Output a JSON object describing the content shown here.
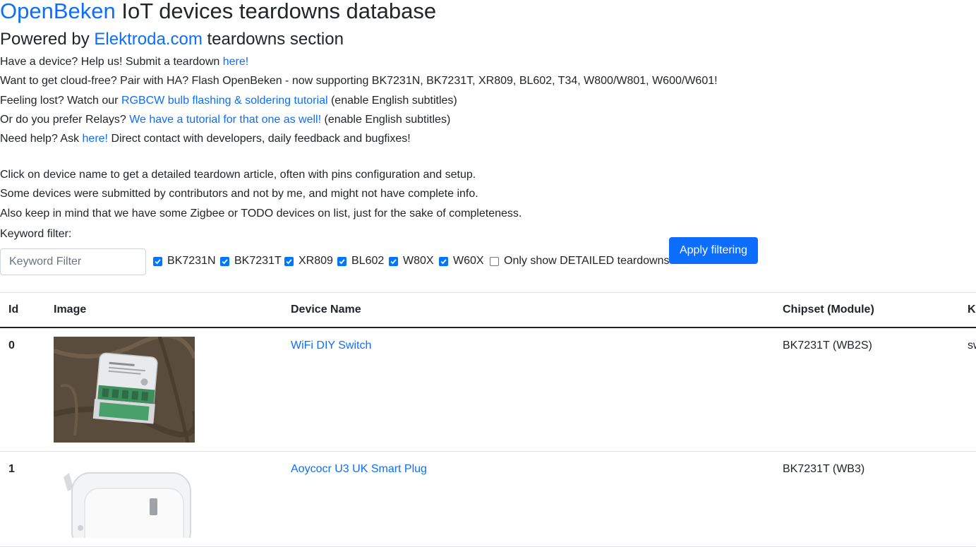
{
  "header": {
    "title_link": "OpenBeken",
    "title_rest": " IoT devices teardowns database",
    "subtitle_prefix": "Powered by ",
    "subtitle_link": "Elektroda.com",
    "subtitle_suffix": " teardowns section"
  },
  "intro": {
    "l1_text": "Have a device? Help us! Submit a teardown ",
    "l1_link": "here!",
    "l2_text": "Want to get cloud-free? Pair with HA? Flash OpenBeken - now supporting BK7231N, BK7231T, XR809, BL602, T34, W800/W801, W600/W601!",
    "l3_text": "Feeling lost? Watch our ",
    "l3_link": "RGBCW bulb flashing & soldering tutorial",
    "l3_after": " (enable English subtitles)",
    "l4_text": "Or do you prefer Relays? ",
    "l4_link": "We have a tutorial for that one as well!",
    "l4_after": " (enable English subtitles)",
    "l5_text": "Need help? Ask ",
    "l5_link": "here!",
    "l5_after": " Direct contact with developers, daily feedback and bugfixes!",
    "p1": "Click on device name to get a detailed teardown article, often with pins configuration and setup.",
    "p2": "Some devices were submitted by contributors and not by me, and might not have complete info.",
    "p3": "Also keep in mind that we have some Zigbee or TODO devices on list, just for the sake of completeness."
  },
  "filter": {
    "label": "Keyword filter:",
    "placeholder": "Keyword Filter",
    "value": "",
    "checkboxes": [
      {
        "label": "BK7231N",
        "checked": true
      },
      {
        "label": "BK7231T",
        "checked": true
      },
      {
        "label": "XR809",
        "checked": true
      },
      {
        "label": "BL602",
        "checked": true
      },
      {
        "label": "W80X",
        "checked": true
      },
      {
        "label": "W60X",
        "checked": true
      },
      {
        "label": "Only show DETAILED teardowns",
        "checked": false
      }
    ],
    "apply_label": "Apply filtering"
  },
  "table": {
    "headers": [
      "Id",
      "Image",
      "Device Name",
      "Chipset (Module)",
      "Ke"
    ],
    "rows": [
      {
        "id": "0",
        "name": "WiFi DIY Switch",
        "chipset": "BK7231T (WB2S)",
        "keywords": "sw"
      },
      {
        "id": "1",
        "name": "Aoycocr U3 UK Smart Plug",
        "chipset": "BK7231T (WB3)",
        "keywords": ""
      }
    ]
  },
  "colors": {
    "link": "#0d6efd",
    "button": "#0d6efd",
    "checkbox": "#0075ff",
    "text": "#212529"
  }
}
